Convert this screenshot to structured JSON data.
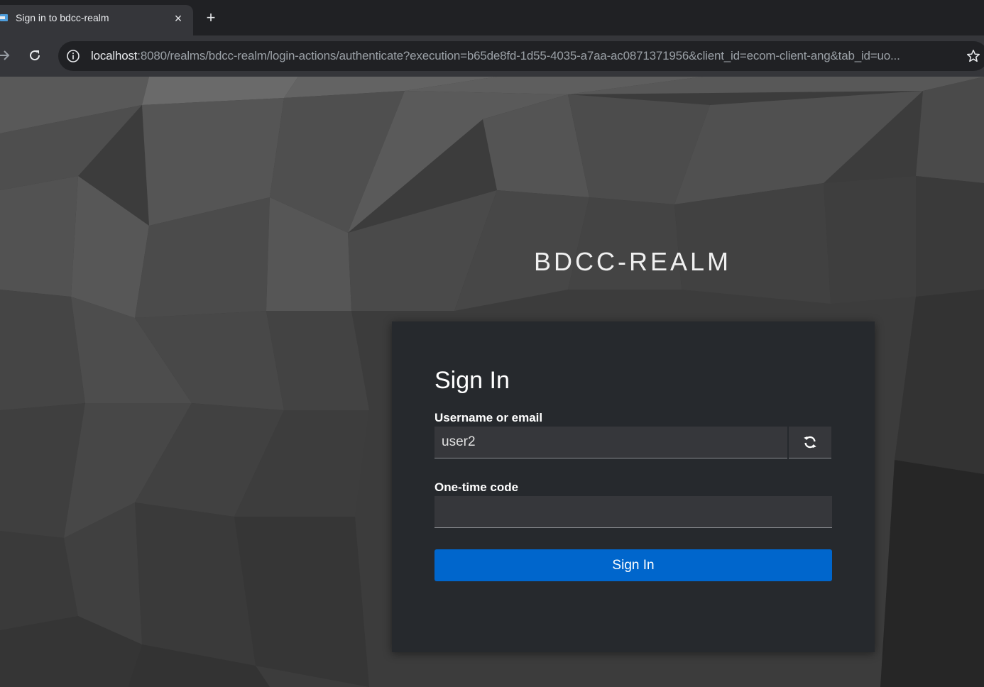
{
  "browser": {
    "tab": {
      "title": "Sign in to bdcc-realm",
      "close_symbol": "×"
    },
    "new_tab_symbol": "+",
    "url": {
      "host": "localhost",
      "rest": ":8080/realms/bdcc-realm/login-actions/authenticate?execution=b65de8fd-1d55-4035-a7aa-ac0871371956&client_id=ecom-client-ang&tab_id=uo..."
    },
    "icons": {
      "forward": "arrow-forward-icon",
      "reload": "reload-icon",
      "info": "info-icon",
      "bookmark": "star-icon",
      "favicon": "keycloak-favicon"
    }
  },
  "login": {
    "realm_name": "BDCC-REALM",
    "card_title": "Sign In",
    "username_label": "Username or email",
    "username_value": "user2",
    "otp_label": "One-time code",
    "otp_value": "",
    "submit_label": "Sign In",
    "restart_icon": "refresh-icon"
  },
  "colors": {
    "primary_button": "#0066cc",
    "card_background": "#26292d",
    "input_background": "#36373b",
    "chrome_background": "#202124",
    "toolbar_background": "#35363a"
  }
}
